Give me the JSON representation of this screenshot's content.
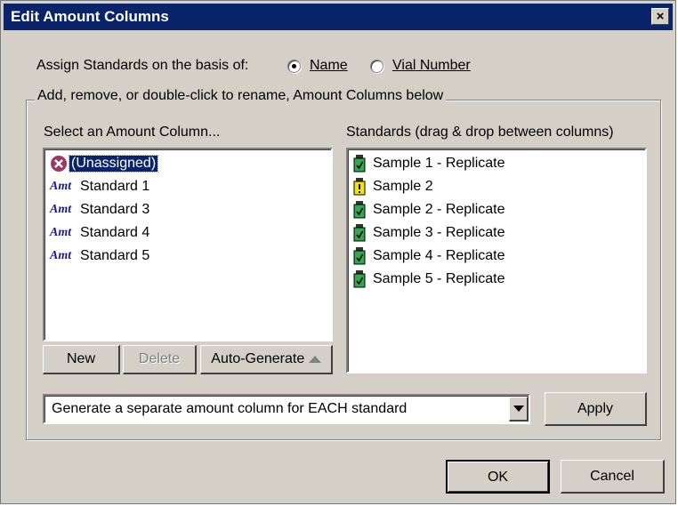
{
  "window": {
    "title": "Edit Amount Columns"
  },
  "assign": {
    "label": "Assign Standards on the basis of:",
    "options": [
      {
        "label": "Name",
        "selected": true
      },
      {
        "label": "Vial Number",
        "selected": false
      }
    ]
  },
  "group_label": "Add, remove, or double-click to rename, Amount Columns below",
  "amount_list": {
    "label": "Select an Amount Column...",
    "items": [
      {
        "label": "(Unassigned)",
        "icon": "unassigned-x-icon",
        "selected": true
      },
      {
        "label": "Standard 1",
        "icon": "amt-icon"
      },
      {
        "label": "Standard 3",
        "icon": "amt-icon"
      },
      {
        "label": "Standard 4",
        "icon": "amt-icon"
      },
      {
        "label": "Standard 5",
        "icon": "amt-icon"
      }
    ],
    "amt_badge": "Amt"
  },
  "standards_list": {
    "label": "Standards (drag & drop between columns)",
    "items": [
      {
        "label": "Sample 1 - Replicate",
        "icon": "vial-check-icon",
        "status": "ok"
      },
      {
        "label": "Sample 2",
        "icon": "vial-warning-icon",
        "status": "warning"
      },
      {
        "label": "Sample 2 - Replicate",
        "icon": "vial-check-icon",
        "status": "ok"
      },
      {
        "label": "Sample 3 - Replicate",
        "icon": "vial-check-icon",
        "status": "ok"
      },
      {
        "label": "Sample 4 - Replicate",
        "icon": "vial-check-icon",
        "status": "ok"
      },
      {
        "label": "Sample 5 - Replicate",
        "icon": "vial-check-icon",
        "status": "ok"
      }
    ]
  },
  "buttons": {
    "new": "New",
    "delete": "Delete",
    "auto_generate": "Auto-Generate",
    "apply": "Apply",
    "ok": "OK",
    "cancel": "Cancel",
    "close": "×"
  },
  "generate_select": {
    "value": "Generate a separate amount column for EACH standard"
  },
  "colors": {
    "title_bar": "#0a246a",
    "selection": "#0a246a",
    "ok_green": "#2fa84f",
    "warn_yellow": "#f2e600"
  }
}
